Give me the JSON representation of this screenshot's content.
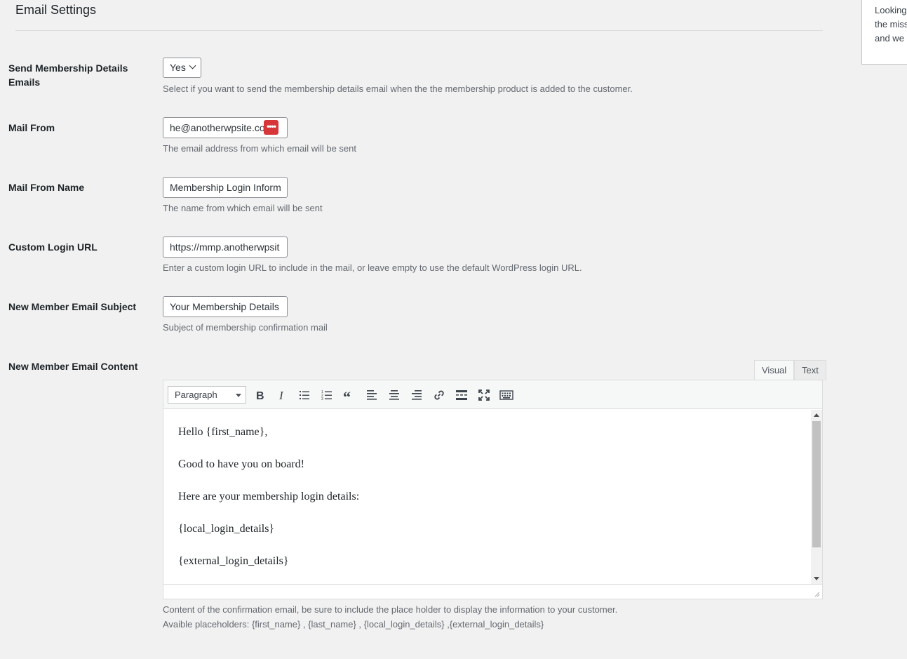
{
  "page": {
    "title": "Email Settings"
  },
  "side_box": {
    "lines": [
      "Looking",
      "the miss",
      "and we"
    ]
  },
  "fields": {
    "send_details": {
      "label": "Send Membership Details Emails",
      "value": "Yes",
      "description": "Select if you want to send the membership details email when the the membership product is added to the customer."
    },
    "mail_from": {
      "label": "Mail From",
      "value": "he@anotherwpsite.co",
      "description": "The email address from which email will be sent"
    },
    "mail_from_name": {
      "label": "Mail From Name",
      "value": "Membership Login Inform",
      "description": "The name from which email will be sent"
    },
    "custom_login_url": {
      "label": "Custom Login URL",
      "value": "https://mmp.anotherwpsit",
      "description": "Enter a custom login URL to include in the mail, or leave empty to use the default WordPress login URL."
    },
    "email_subject": {
      "label": "New Member Email Subject",
      "value": "Your Membership Details",
      "description": "Subject of membership confirmation mail"
    },
    "email_content": {
      "label": "New Member Email Content",
      "description": "Content of the confirmation email, be sure to include the place holder to display the information to your customer.",
      "placeholders": "Avaible placeholders: {first_name} , {last_name} , {local_login_details} ,{external_login_details}"
    }
  },
  "editor": {
    "tabs": {
      "visual": "Visual",
      "text": "Text"
    },
    "format": "Paragraph",
    "toolbar_icons": [
      "bold-icon",
      "italic-icon",
      "bullet-list-icon",
      "numbered-list-icon",
      "blockquote-icon",
      "align-left-icon",
      "align-center-icon",
      "align-right-icon",
      "link-icon",
      "read-more-icon",
      "fullscreen-icon",
      "keyboard-icon"
    ],
    "paragraphs": [
      "Hello {first_name},",
      "Good to have you on board!",
      "Here are your membership login details:",
      "{local_login_details}",
      "{external_login_details}"
    ]
  },
  "password_badge": "••••"
}
